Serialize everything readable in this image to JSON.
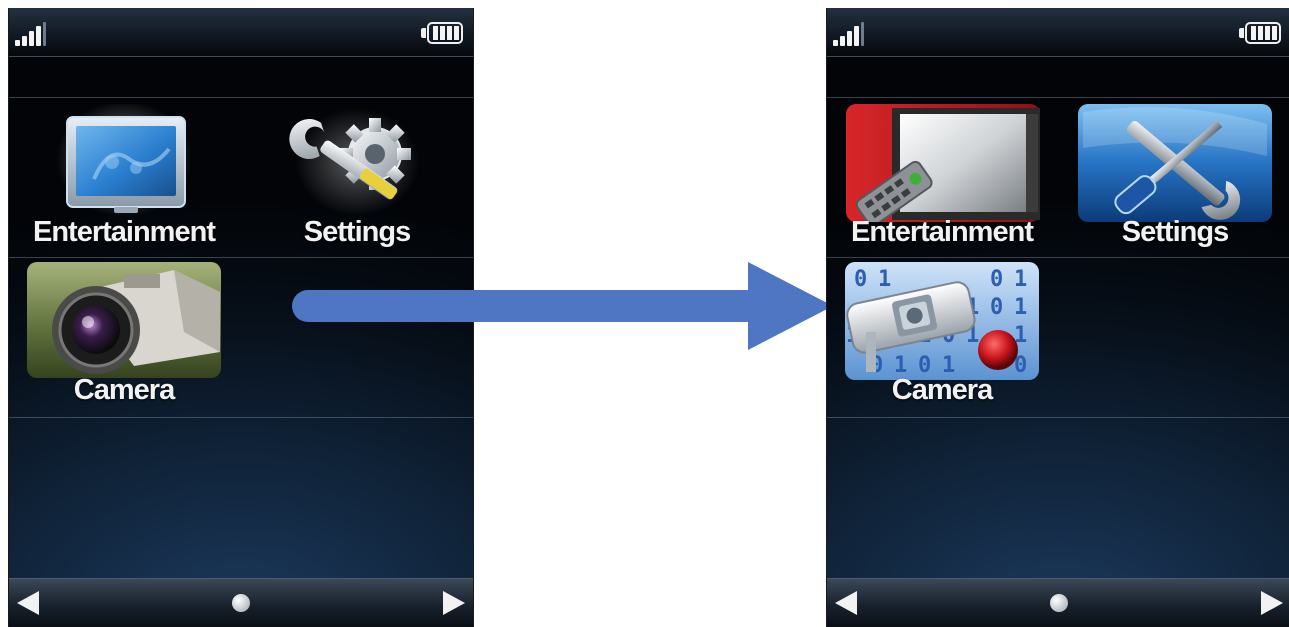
{
  "screens": {
    "before": {
      "apps": [
        {
          "label": "Entertainment",
          "icon": "tv-icon"
        },
        {
          "label": "Settings",
          "icon": "wrench-gear-icon"
        },
        {
          "label": "Camera",
          "icon": "camera-icon"
        }
      ]
    },
    "after": {
      "apps": [
        {
          "label": "Entertainment",
          "icon": "tv-remote-icon"
        },
        {
          "label": "Settings",
          "icon": "wrench-screwdriver-icon"
        },
        {
          "label": "Camera",
          "icon": "security-camera-icon"
        }
      ],
      "camera_icon_digits": [
        "0",
        "1",
        "0",
        "1",
        "1",
        "0",
        "1",
        "1",
        "0",
        "1",
        "0",
        "1",
        "1",
        "0",
        "1",
        "0",
        "1",
        "0"
      ]
    }
  },
  "colors": {
    "arrow": "#4f76c2",
    "label": "#f2f2f2"
  }
}
